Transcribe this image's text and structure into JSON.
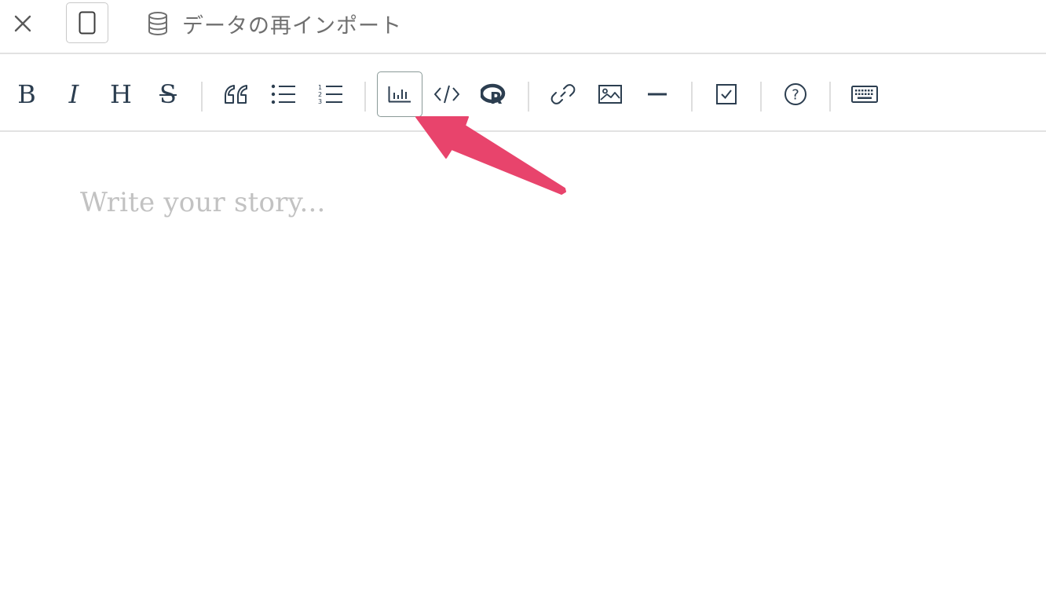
{
  "topbar": {
    "close_icon": "close-icon",
    "device_icon": "tablet-icon",
    "reimport_icon": "database-icon",
    "reimport_label": "データの再インポート"
  },
  "toolbar": {
    "items": [
      {
        "name": "bold",
        "glyph": "B"
      },
      {
        "name": "italic",
        "glyph": "I"
      },
      {
        "name": "heading",
        "glyph": "H"
      },
      {
        "name": "strikethrough",
        "glyph": "S"
      },
      {
        "name": "quote",
        "icon": "quote-icon"
      },
      {
        "name": "bullet-list",
        "icon": "bullet-list-icon"
      },
      {
        "name": "numbered-list",
        "icon": "numbered-list-icon",
        "numbers": [
          "1",
          "2",
          "3"
        ]
      },
      {
        "name": "chart",
        "icon": "bar-chart-icon",
        "active": true
      },
      {
        "name": "code",
        "icon": "code-icon"
      },
      {
        "name": "r-code",
        "icon": "r-logo-icon",
        "glyph": "R"
      },
      {
        "name": "link",
        "icon": "link-icon"
      },
      {
        "name": "image",
        "icon": "image-icon"
      },
      {
        "name": "horizontal-rule",
        "icon": "horizontal-rule-icon"
      },
      {
        "name": "checkbox",
        "icon": "checkbox-icon"
      },
      {
        "name": "help",
        "glyph": "?"
      },
      {
        "name": "keyboard",
        "icon": "keyboard-icon"
      }
    ]
  },
  "editor": {
    "placeholder": "Write your story..."
  },
  "colors": {
    "icon": "#2c3e50",
    "arrow": "#e8446c",
    "placeholder": "#c2c2c2",
    "divider": "#e2e2e2"
  }
}
